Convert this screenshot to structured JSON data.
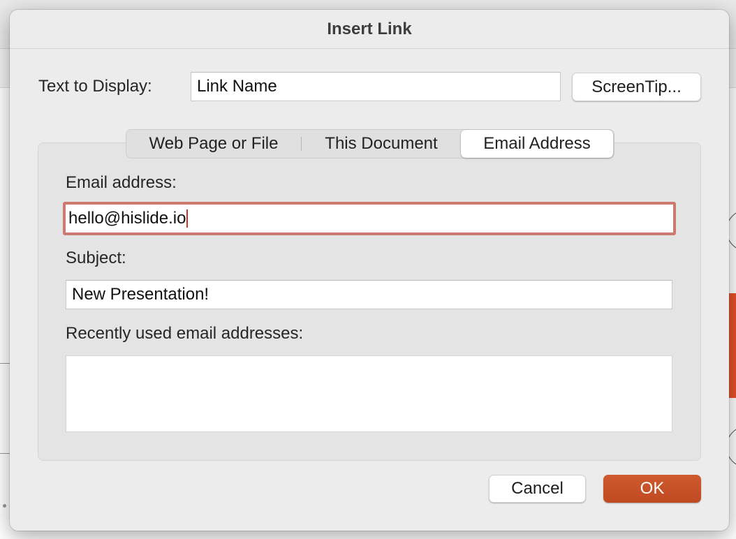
{
  "dialog": {
    "title": "Insert Link",
    "text_to_display_label": "Text to Display:",
    "text_to_display_value": "Link Name",
    "screentip_label": "ScreenTip...",
    "tabs": [
      {
        "label": "Web Page or File",
        "selected": false
      },
      {
        "label": "This Document",
        "selected": false
      },
      {
        "label": "Email Address",
        "selected": true
      }
    ],
    "email_label": "Email address:",
    "email_value": "hello@hislide.io",
    "subject_label": "Subject:",
    "subject_value": "New Presentation!",
    "recent_label": "Recently used email addresses:",
    "recent_items": [],
    "cancel_label": "Cancel",
    "ok_label": "OK"
  },
  "colors": {
    "ok_button": "#c8522a",
    "focus_ring": "#cd7b72",
    "sheet_bg": "#ececec"
  }
}
